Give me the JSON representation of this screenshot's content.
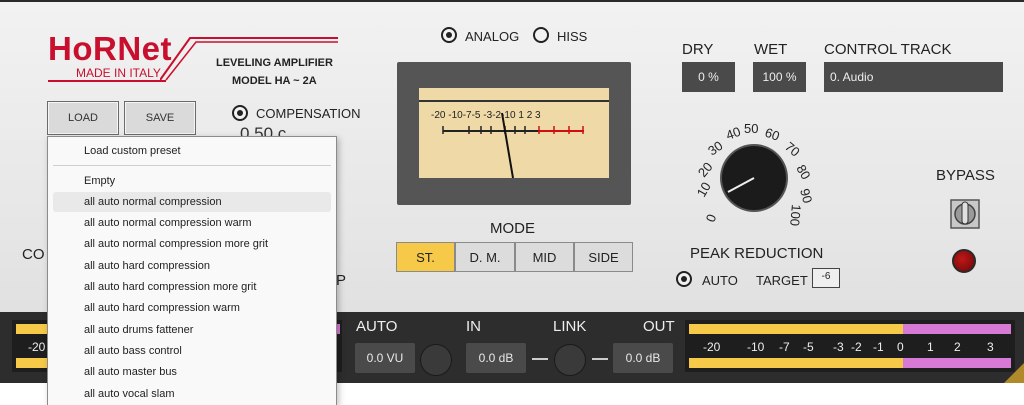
{
  "brand": {
    "logo": "HoRNet",
    "made_in": "MADE IN ITALY",
    "product_line1": "LEVELING AMPLIFIER",
    "product_line2": "MODEL HA ~ 2A"
  },
  "buttons": {
    "load": "LOAD",
    "save": "SAVE"
  },
  "compensation": {
    "label": "COMPENSATION",
    "value": "0.50 c",
    "selected": true
  },
  "meter_mode": {
    "analog_label": "ANALOG",
    "analog_selected": true,
    "hiss_label": "HISS",
    "hiss_selected": false
  },
  "vu": {
    "scale": [
      "-20",
      "-10",
      "-7",
      "-5",
      "-3",
      "-2",
      "-1",
      "0",
      "1",
      "2",
      "3"
    ]
  },
  "mode": {
    "label": "MODE",
    "options": [
      "ST.",
      "D. M.",
      "MID",
      "SIDE"
    ],
    "active": "ST."
  },
  "dry": {
    "label": "DRY",
    "value": "0 %"
  },
  "wet": {
    "label": "WET",
    "value": "100 %"
  },
  "control_track": {
    "label": "CONTROL TRACK",
    "value": "0. Audio"
  },
  "peak_reduction": {
    "label": "PEAK REDUCTION",
    "dial_numbers": [
      "0",
      "10",
      "20",
      "30",
      "40",
      "50",
      "60",
      "70",
      "80",
      "90",
      "100"
    ],
    "auto_label": "AUTO",
    "auto_selected": true,
    "target_label": "TARGET",
    "target_value": "-6"
  },
  "bypass": {
    "label": "BYPASS"
  },
  "partial_labels": {
    "left": "CO",
    "right": "P"
  },
  "bottom": {
    "auto_label": "AUTO",
    "in_label": "IN",
    "link_label": "LINK",
    "out_label": "OUT",
    "auto_value": "0.0 VU",
    "in_value": "0.0 dB",
    "out_value": "0.0 dB",
    "left_meter_partial": "-20",
    "meter_scale": [
      "-20",
      "-10",
      "-7",
      "-5",
      "-3",
      "-2",
      "-1",
      "0",
      "1",
      "2",
      "3"
    ]
  },
  "preset_menu": {
    "items": [
      "Load custom preset",
      "Empty",
      "all auto normal compression",
      "all auto normal compression warm",
      "all auto normal compression more grit",
      "all auto hard compression",
      "all auto hard compression more grit",
      "all auto hard compression warm",
      "all auto drums fattener",
      "all auto bass control",
      "all auto master bus",
      "all auto vocal slam"
    ],
    "highlighted": "all auto normal compression"
  },
  "colors": {
    "accent_red": "#c8102e",
    "meter_yellow": "#f7c948",
    "meter_pink": "#d67ad6",
    "mode_active": "#f7c948"
  }
}
